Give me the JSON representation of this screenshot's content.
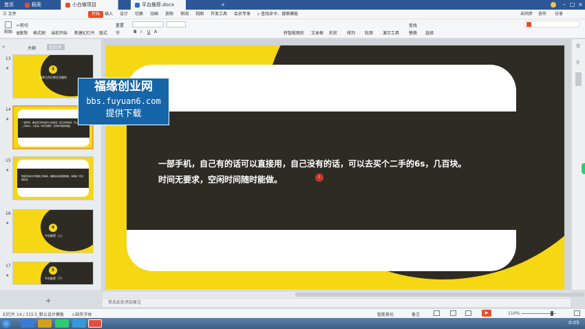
{
  "tabs": [
    {
      "label": "首页"
    },
    {
      "label": "稻壳"
    },
    {
      "label": "小白做项目1.0.pptx"
    },
    {
      "label": "平台推荐.docx"
    }
  ],
  "new_tab": "+",
  "menu": [
    "三 文件",
    "开始",
    "插入",
    "设计",
    "切换",
    "动画",
    "放映",
    "审阅",
    "视图",
    "开发工具",
    "会员专享"
  ],
  "search_label": "查找命令、搜索模板",
  "menu_right": [
    "未同步",
    "协作",
    "分享"
  ],
  "ribbon": {
    "paste": "粘贴",
    "cut": "剪切",
    "copy": "复制",
    "format_painter": "格式刷",
    "from_current": "当前开始",
    "new_slide": "新建幻灯片",
    "layout": "版式",
    "section": "节",
    "reset": "重置",
    "textbox": "文本框",
    "shape": "形状",
    "arrange": "排列",
    "outline": "轮廓",
    "present_tools": "演示工具",
    "find": "查找",
    "replace": "替换",
    "select": "选择",
    "convert_art": "转智能图形"
  },
  "panel_tabs": {
    "outline": "大纲",
    "slides": "幻灯片"
  },
  "slides": [
    {
      "num": "13",
      "number": "3",
      "title": "选择工作日常生活顺利"
    },
    {
      "num": "14",
      "text": "一部手机，看过自己有的话可以直接用，自己没有的话，可以去买个二手的6s，几百块。时间无要求，空闲时间随时能做。"
    },
    {
      "num": "15",
      "text": "家庭空间多平手数据上传等的，需要资本实施型数据，请能够一定问题时间。"
    },
    {
      "num": "16",
      "number": "4",
      "title": "平台推荐（上）"
    },
    {
      "num": "17",
      "number": "5",
      "title": "平台推荐（下）"
    }
  ],
  "add_slide": "+",
  "slide_main": {
    "line1": "一部手机，自己有的话可以直接用，自己没有的话，可以去买个二手的6s，几百块。",
    "line2": "时间无要求，空闲时间随时能做。"
  },
  "watermark": {
    "line1": "福缘创业网",
    "line2": "bbs.fuyuan6.com",
    "line3": "提供下载"
  },
  "note_placeholder": "单击此处添加备注",
  "status": {
    "slide_pos": "幻灯片 14 / 115",
    "theme": "3_默认设计模板",
    "font_missing": "缺失字体",
    "smart_beautify": "智能美化",
    "notes": "备注",
    "zoom": "110%"
  },
  "clock": "0:05",
  "colors": {
    "accent": "#e94d2a",
    "slide_yellow": "#f5d714",
    "slide_dark": "#2e2b24",
    "watermark_blue": "#1565a8"
  }
}
